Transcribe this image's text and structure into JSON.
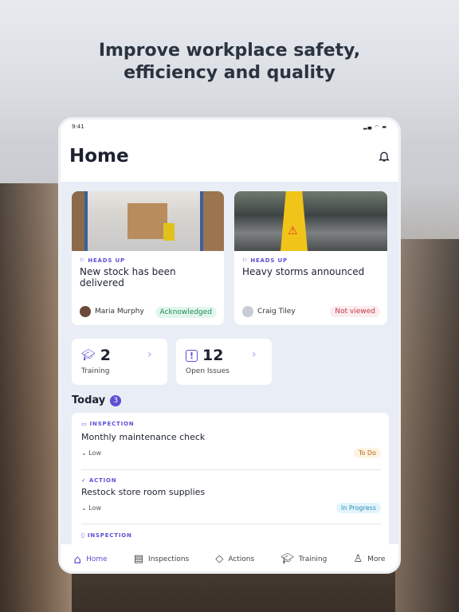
{
  "headline": {
    "line1": "Improve workplace safety,",
    "line2": "efficiency and quality"
  },
  "status_bar": {
    "time": "9:41"
  },
  "header": {
    "title": "Home",
    "bell_icon": "bell-icon"
  },
  "announcements": [
    {
      "tag": "HEADS UP",
      "title": "New stock has been delivered",
      "author": "Maria Murphy",
      "status": "Acknowledged",
      "status_color": "#1f8a5b",
      "status_bg": "#e3f6ec"
    },
    {
      "tag": "HEADS UP",
      "title": "Heavy storms announced",
      "author": "Craig Tiley",
      "status": "Not viewed",
      "status_color": "#c0394a",
      "status_bg": "#fdecee"
    }
  ],
  "stats": [
    {
      "value": "2",
      "label": "Training",
      "icon": "graduation-cap-icon"
    },
    {
      "value": "12",
      "label": "Open Issues",
      "icon": "alert-bubble-icon"
    }
  ],
  "today": {
    "label": "Today",
    "count": "3"
  },
  "tasks": [
    {
      "type": "INSPECTION",
      "title": "Monthly maintenance check",
      "priority": "Low",
      "status": "To Do",
      "status_color": "#b8661a",
      "status_bg": "#fdf3e3"
    },
    {
      "type": "ACTION",
      "title": "Restock store room supplies",
      "priority": "Low",
      "status": "In Progress",
      "status_color": "#2a8bb8",
      "status_bg": "#e3f4fb"
    },
    {
      "type": "INSPECTION"
    }
  ],
  "nav": [
    {
      "label": "Home"
    },
    {
      "label": "Inspections"
    },
    {
      "label": "Actions"
    },
    {
      "label": "Training"
    },
    {
      "label": "More"
    }
  ],
  "accent": "#5b4fd6"
}
